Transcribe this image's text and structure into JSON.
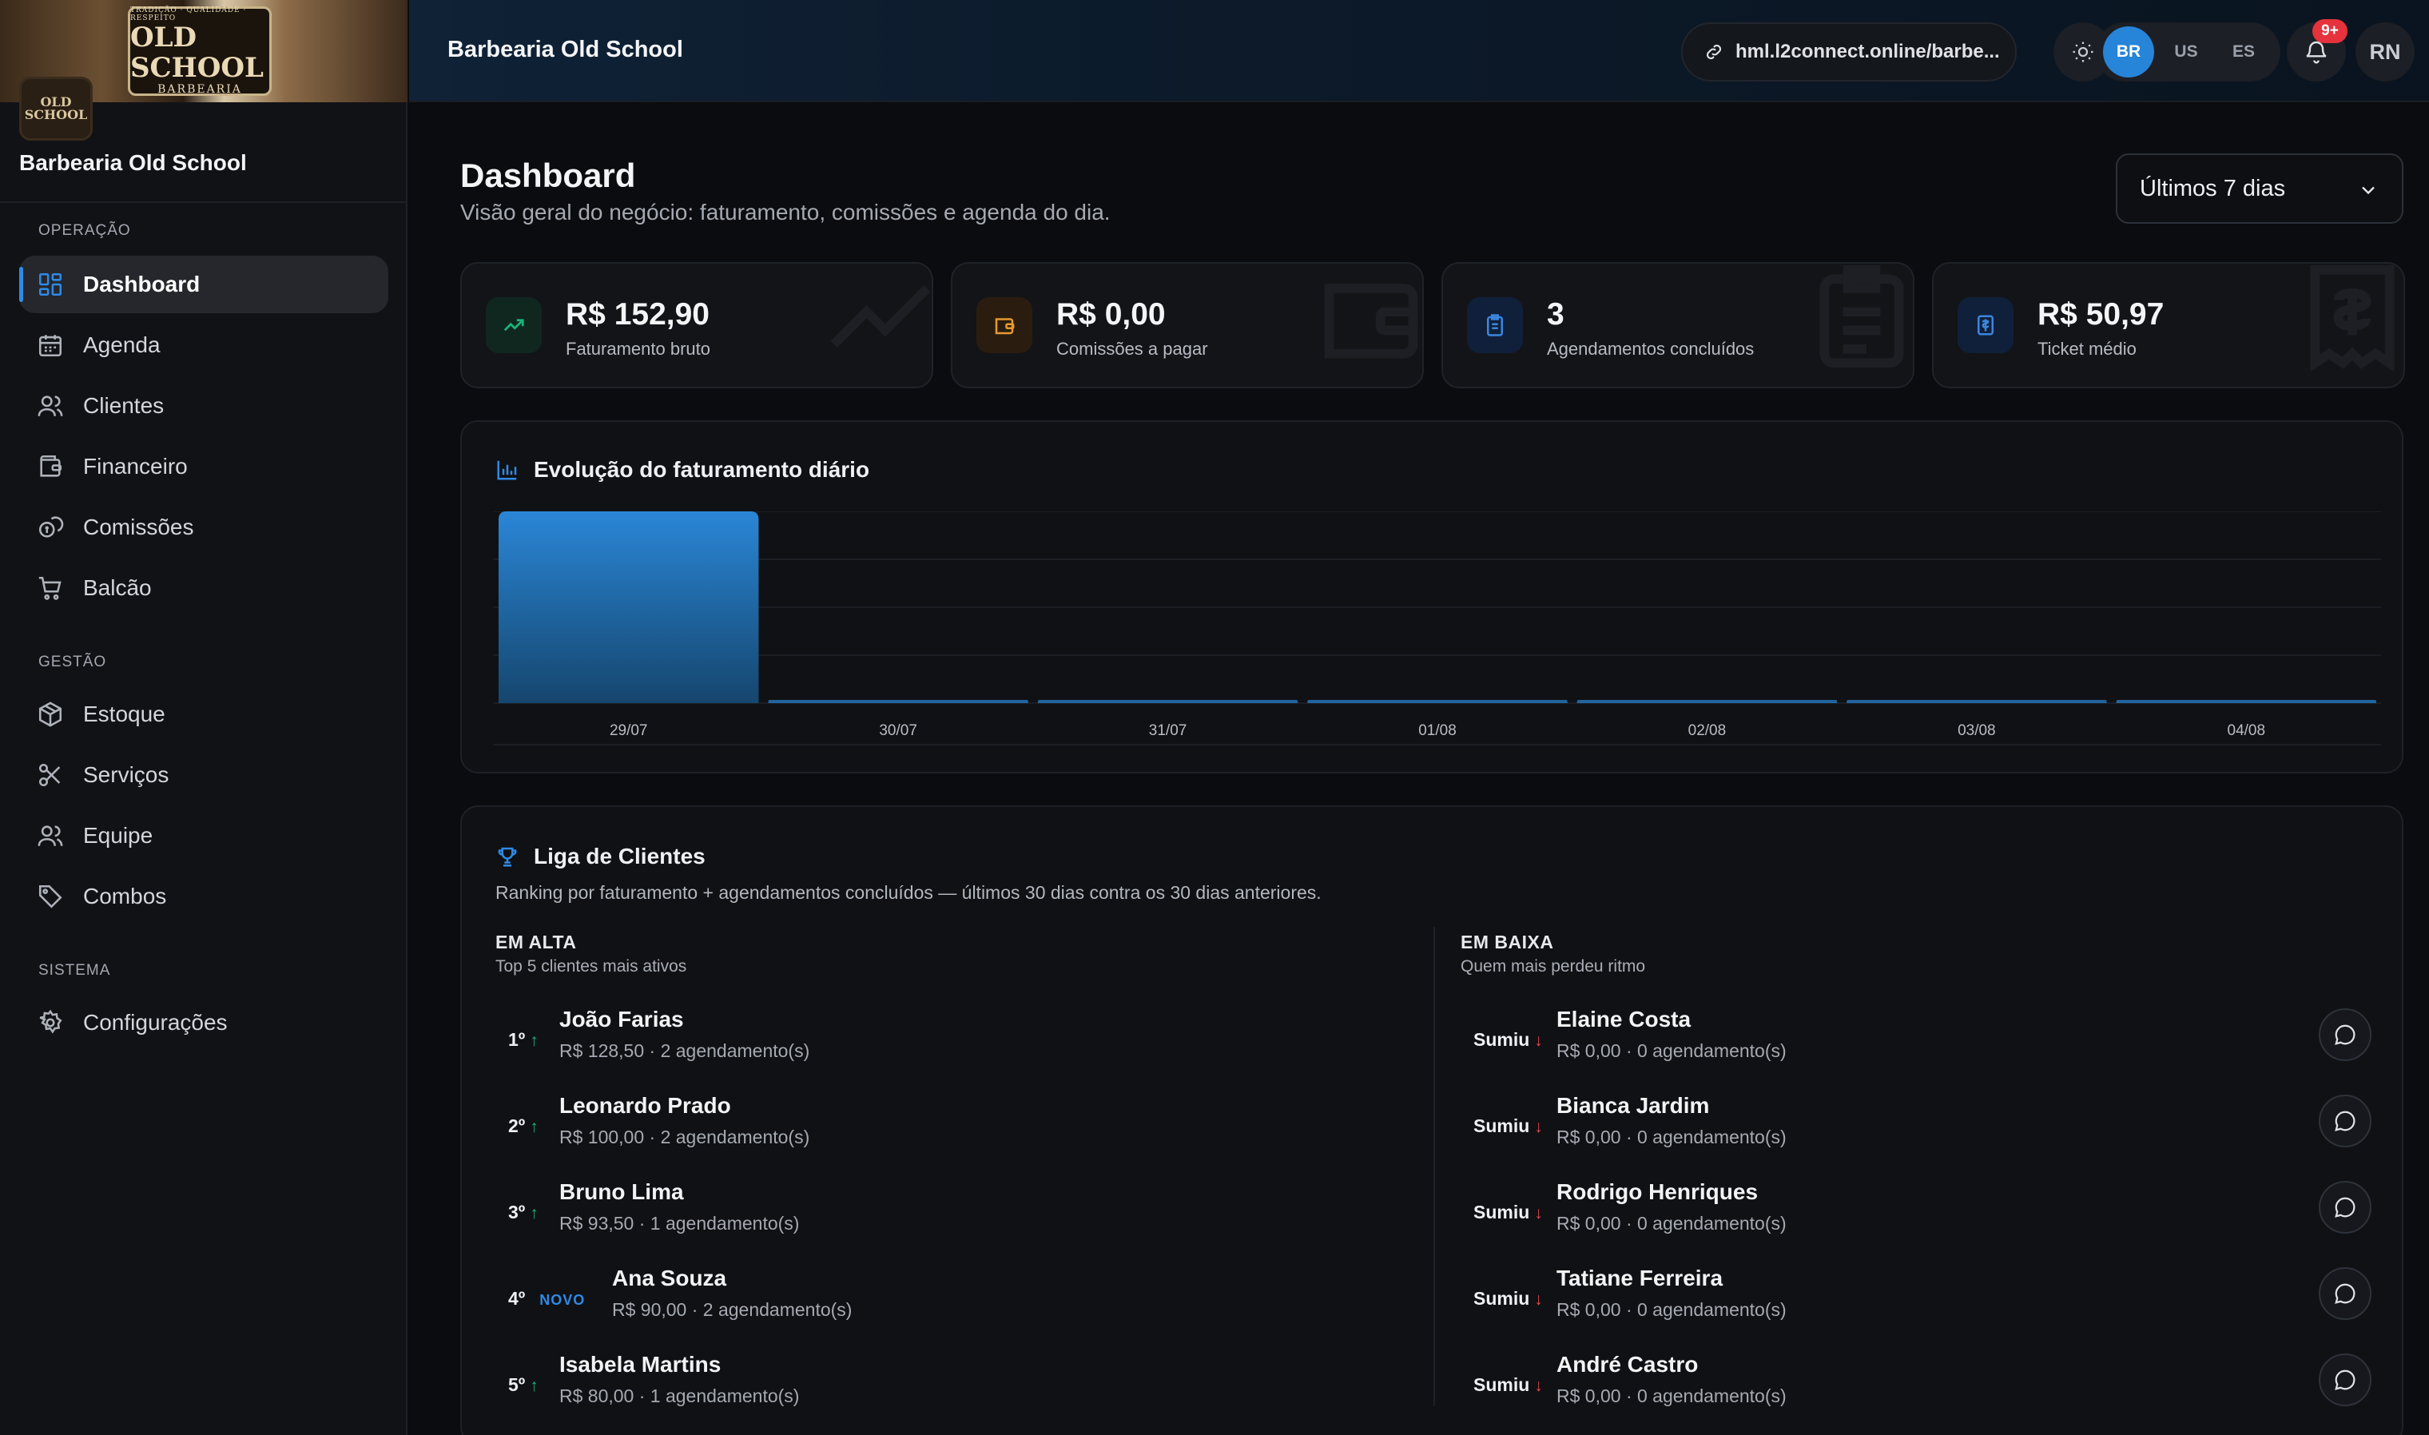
{
  "app": {
    "brand_name": "Barbearia Old School",
    "banner": {
      "top_text": "TRADIÇÃO · QUALIDADE · RESPEITO",
      "logo_text": "OLD SCHOOL",
      "logo_sub": "BARBEARIA",
      "badge_text": "OLD SCHOOL"
    }
  },
  "sidebar": {
    "sections": [
      {
        "label": "OPERAÇÃO",
        "items": [
          {
            "label": "Dashboard",
            "icon": "dashboard-icon",
            "active": true
          },
          {
            "label": "Agenda",
            "icon": "calendar-icon"
          },
          {
            "label": "Clientes",
            "icon": "users-icon"
          },
          {
            "label": "Financeiro",
            "icon": "wallet-icon"
          },
          {
            "label": "Comissões",
            "icon": "coins-icon"
          },
          {
            "label": "Balcão",
            "icon": "cart-icon"
          }
        ]
      },
      {
        "label": "GESTÃO",
        "items": [
          {
            "label": "Estoque",
            "icon": "box-icon"
          },
          {
            "label": "Serviços",
            "icon": "scissors-icon"
          },
          {
            "label": "Equipe",
            "icon": "team-icon"
          },
          {
            "label": "Combos",
            "icon": "tag-icon"
          }
        ]
      },
      {
        "label": "SISTEMA",
        "items": [
          {
            "label": "Configurações",
            "icon": "gear-icon"
          }
        ]
      }
    ]
  },
  "topbar": {
    "title": "Barbearia Old School",
    "url": "hml.l2connect.online/barbe...",
    "languages": [
      "BR",
      "US",
      "ES"
    ],
    "active_language": "BR",
    "notifications_badge": "9+",
    "user_initials": "RN"
  },
  "page": {
    "title": "Dashboard",
    "subtitle": "Visão geral do negócio: faturamento, comissões e agenda do dia.",
    "period": "Últimos 7 dias"
  },
  "stats": [
    {
      "value": "R$ 152,90",
      "label": "Faturamento bruto",
      "icon": "trend-up-icon",
      "color": "#19b37a"
    },
    {
      "value": "R$ 0,00",
      "label": "Comissões a pagar",
      "icon": "wallet-icon",
      "color": "#e69a2f"
    },
    {
      "value": "3",
      "label": "Agendamentos concluídos",
      "icon": "clipboard-icon",
      "color": "#3b86e0"
    },
    {
      "value": "R$ 50,97",
      "label": "Ticket médio",
      "icon": "receipt-icon",
      "color": "#3b86e0"
    }
  ],
  "chart_data": {
    "type": "bar",
    "title": "Evolução do faturamento diário",
    "categories": [
      "29/07",
      "30/07",
      "31/07",
      "01/08",
      "02/08",
      "03/08",
      "04/08"
    ],
    "values": [
      152.9,
      0,
      0,
      0,
      0,
      0,
      0
    ],
    "ylim": [
      0,
      152.9
    ],
    "grid": true,
    "colors": {
      "bar_top": "#2a86d6",
      "bar_bottom": "#15466e"
    }
  },
  "league": {
    "title": "Liga de Clientes",
    "subtitle": "Ranking por faturamento + agendamentos concluídos — últimos 30 dias contra os 30 dias anteriores.",
    "up": {
      "heading": "EM ALTA",
      "subheading": "Top 5 clientes mais ativos",
      "color": "#19b37a",
      "items": [
        {
          "pos": "1º",
          "trend": "↑",
          "name": "João Farias",
          "meta": "R$ 128,50 · 2 agendamento(s)"
        },
        {
          "pos": "2º",
          "trend": "↑",
          "name": "Leonardo Prado",
          "meta": "R$ 100,00 · 2 agendamento(s)"
        },
        {
          "pos": "3º",
          "trend": "↑",
          "name": "Bruno Lima",
          "meta": "R$ 93,50 · 1 agendamento(s)"
        },
        {
          "pos": "4º",
          "badge": "NOVO",
          "name": "Ana Souza",
          "meta": "R$ 90,00 · 2 agendamento(s)"
        },
        {
          "pos": "5º",
          "trend": "↑",
          "name": "Isabela Martins",
          "meta": "R$ 80,00 · 1 agendamento(s)"
        }
      ]
    },
    "down": {
      "heading": "EM BAIXA",
      "subheading": "Quem mais perdeu ritmo",
      "color": "#e5484d",
      "items": [
        {
          "pos": "Sumiu",
          "trend": "↓",
          "name": "Elaine Costa",
          "meta": "R$ 0,00 · 0 agendamento(s)"
        },
        {
          "pos": "Sumiu",
          "trend": "↓",
          "name": "Bianca Jardim",
          "meta": "R$ 0,00 · 0 agendamento(s)"
        },
        {
          "pos": "Sumiu",
          "trend": "↓",
          "name": "Rodrigo Henriques",
          "meta": "R$ 0,00 · 0 agendamento(s)"
        },
        {
          "pos": "Sumiu",
          "trend": "↓",
          "name": "Tatiane Ferreira",
          "meta": "R$ 0,00 · 0 agendamento(s)"
        },
        {
          "pos": "Sumiu",
          "trend": "↓",
          "name": "André Castro",
          "meta": "R$ 0,00 · 0 agendamento(s)"
        }
      ]
    }
  }
}
